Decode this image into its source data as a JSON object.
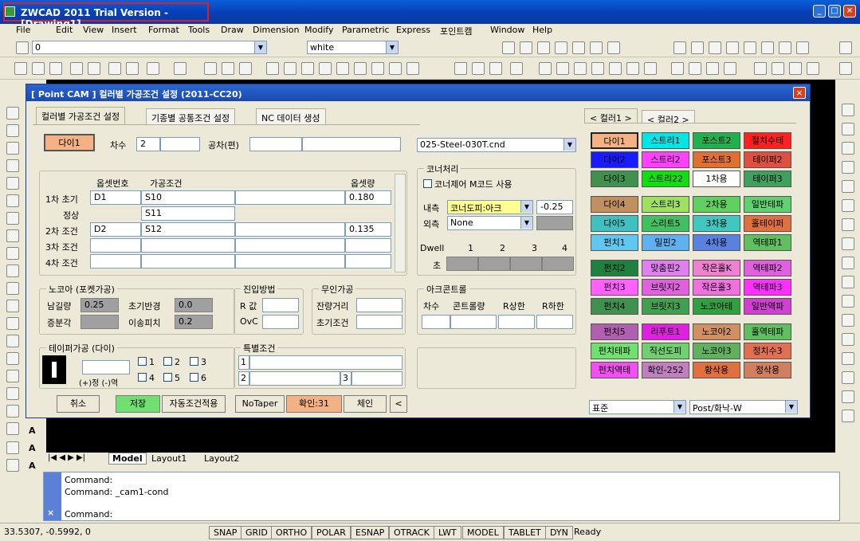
{
  "window": {
    "title": "ZWCAD 2011 Trial Version - [Drawing1]"
  },
  "menu": [
    "File",
    "Edit",
    "View",
    "Insert",
    "Format",
    "Tools",
    "Draw",
    "Dimension",
    "Modify",
    "Parametric",
    "Express",
    "포인트캠",
    "Window",
    "Help"
  ],
  "toolbar": {
    "layer_value": "0",
    "color_value": "white"
  },
  "dialog": {
    "title": "[ Point CAM ]  컬러별 가공조건 설정  (2011-CC20)",
    "tabs": [
      "컬러별 가공조건 설정",
      "기종별 공통조건 설정",
      "NC 데이터 생성"
    ],
    "color_button": "다이1",
    "chasu_label": "차수",
    "chasu_value": "2",
    "gongcha_label": "공차(편)",
    "material_value": "025-Steel-030T.cnd",
    "offset_no_header": "옵셋번호",
    "process_header": "가공조건",
    "offset_amt_header": "옵셋량",
    "rows": [
      {
        "label": "1차 초기",
        "offset": "D1",
        "cond": "S10",
        "amt": "0.180"
      },
      {
        "label": "정상",
        "offset": "",
        "cond": "S11",
        "amt": ""
      },
      {
        "label": "2차 조건",
        "offset": "D2",
        "cond": "S12",
        "amt": "0.135"
      },
      {
        "label": "3차 조건",
        "offset": "",
        "cond": "",
        "amt": ""
      },
      {
        "label": "4차 조건",
        "offset": "",
        "cond": "",
        "amt": ""
      }
    ],
    "corner": {
      "title": "코너처리",
      "mcode_label": "코너제어 M코드 사용",
      "inner_label": "내측",
      "inner_value": "코너도피:아크",
      "inner_num": "-0.25",
      "outer_label": "외측",
      "outer_value": "None",
      "dwell_label": "Dwell",
      "dwell_nums": [
        "1",
        "2",
        "3",
        "4"
      ],
      "cho_label": "초"
    },
    "nocoa": {
      "title": "노코아 (포켓가공)",
      "namgil_label": "남길량",
      "namgil_value": "0.25",
      "chogi_label": "초기반경",
      "chogi_value": "0.0",
      "jeungbun_label": "증분각",
      "iseong_label": "이송피치",
      "iseong_value": "0.2"
    },
    "approach": {
      "title": "진입방법",
      "r_label": "R 값",
      "ovc_label": "OvC"
    },
    "unmanned": {
      "title": "무인가공",
      "remain_label": "잔량거리",
      "init_label": "초기조건"
    },
    "arc": {
      "title": "아크콘트롤",
      "cols": [
        "차수",
        "콘트롤량",
        "R상한",
        "R하한"
      ]
    },
    "taper": {
      "title": "테이퍼가공 (다이)",
      "nums": [
        "1",
        "2",
        "3",
        "4",
        "5",
        "6"
      ],
      "sign_label": "(+)정 (-)역"
    },
    "special": {
      "title": "특별조건",
      "nums": [
        "1",
        "2",
        "3"
      ]
    },
    "buttons": {
      "cancel": "취소",
      "save": "저장",
      "auto": "자동조건적용",
      "notaper": "NoTaper",
      "confirm": "확인:31",
      "chein": "체인",
      "back": "<"
    },
    "color_tabs": [
      "< 컬러1 >",
      "< 컬러2 >"
    ],
    "color_cells": [
      {
        "label": "다이1",
        "bg": "#f4b183"
      },
      {
        "label": "스트리1",
        "bg": "#00e5e5"
      },
      {
        "label": "포스트2",
        "bg": "#20b050"
      },
      {
        "label": "절치수테",
        "bg": "#ff2020"
      },
      {
        "label": "다이2",
        "bg": "#1a1aff"
      },
      {
        "label": "스트리2",
        "bg": "#ff40ff"
      },
      {
        "label": "포스트3",
        "bg": "#e07030"
      },
      {
        "label": "테이퍼2",
        "bg": "#e05040"
      },
      {
        "label": "다이3",
        "bg": "#409050"
      },
      {
        "label": "스트리22",
        "bg": "#10e010"
      },
      {
        "label": "1차용",
        "bg": "#ffffff"
      },
      {
        "label": "테이퍼3",
        "bg": "#40a060"
      },
      {
        "label": "다이4",
        "bg": "#c09060"
      },
      {
        "label": "스트리3",
        "bg": "#a0e060"
      },
      {
        "label": "2차용",
        "bg": "#60d060"
      },
      {
        "label": "일반테파",
        "bg": "#60d070"
      },
      {
        "label": "다이5",
        "bg": "#40c0c0"
      },
      {
        "label": "스리트5",
        "bg": "#40c060"
      },
      {
        "label": "3차용",
        "bg": "#40c8c0"
      },
      {
        "label": "홀테이퍼",
        "bg": "#e07040"
      },
      {
        "label": "펀치1",
        "bg": "#60c8f0"
      },
      {
        "label": "밀핀2",
        "bg": "#60b0f0"
      },
      {
        "label": "4차용",
        "bg": "#5a80e0"
      },
      {
        "label": "역테파1",
        "bg": "#60c060"
      },
      {
        "label": "펀치2",
        "bg": "#208040"
      },
      {
        "label": "맞춤핀2",
        "bg": "#e080f0"
      },
      {
        "label": "작은홀K",
        "bg": "#f080d0"
      },
      {
        "label": "역테파2",
        "bg": "#e060e0"
      },
      {
        "label": "펀치3",
        "bg": "#ff60ff"
      },
      {
        "label": "브릿지2",
        "bg": "#e060e0"
      },
      {
        "label": "작은홀3",
        "bg": "#f070e0"
      },
      {
        "label": "역테파3",
        "bg": "#ff30ff"
      },
      {
        "label": "펀치4",
        "bg": "#409050"
      },
      {
        "label": "브릿지3",
        "bg": "#40a050"
      },
      {
        "label": "노코아테",
        "bg": "#30a040"
      },
      {
        "label": "일반역파",
        "bg": "#d040d0"
      },
      {
        "label": "펀치5",
        "bg": "#b060b0"
      },
      {
        "label": "리푸트1",
        "bg": "#e020e0"
      },
      {
        "label": "노코아2",
        "bg": "#d09060"
      },
      {
        "label": "홀역테파",
        "bg": "#60c060"
      },
      {
        "label": "펀치테파",
        "bg": "#70e070"
      },
      {
        "label": "직선도피",
        "bg": "#70d070"
      },
      {
        "label": "노코아3",
        "bg": "#60b060"
      },
      {
        "label": "정치수3",
        "bg": "#e07050"
      },
      {
        "label": "펀치역테",
        "bg": "#f050f0"
      },
      {
        "label": "확인-252",
        "bg": "#c080c0"
      },
      {
        "label": "황삭용",
        "bg": "#e07040"
      },
      {
        "label": "정삭용",
        "bg": "#d08060"
      }
    ],
    "std_select": "표준",
    "post_select": "Post/화낙-W"
  },
  "layout_tabs": [
    "Model",
    "Layout1",
    "Layout2"
  ],
  "command": {
    "line1": "Command:",
    "line2": "Command: _cam1-cond",
    "prompt": "Command:"
  },
  "status": {
    "coords": "33.5307,  -0.5992,  0",
    "buttons": [
      "SNAP",
      "GRID",
      "ORTHO",
      "POLAR",
      "ESNAP",
      "OTRACK",
      "LWT",
      "MODEL",
      "TABLET",
      "DYN"
    ],
    "ready": "Ready"
  }
}
